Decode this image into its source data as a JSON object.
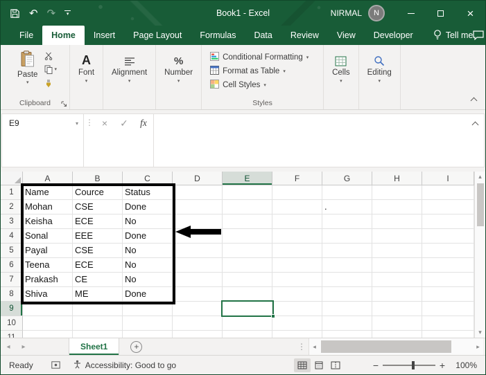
{
  "window": {
    "title": "Book1 - Excel",
    "user_name": "NIRMAL",
    "user_initial": "N"
  },
  "ribbon_tabs": {
    "active": "Home",
    "items": [
      "File",
      "Home",
      "Insert",
      "Page Layout",
      "Formulas",
      "Data",
      "Review",
      "View",
      "Developer"
    ],
    "tell_me": "Tell me"
  },
  "ribbon": {
    "paste_label": "Paste",
    "clipboard_group_label": "Clipboard",
    "font_label": "Font",
    "alignment_label": "Alignment",
    "number_label": "Number",
    "conditional_formatting_label": "Conditional Formatting",
    "format_as_table_label": "Format as Table",
    "cell_styles_label": "Cell Styles",
    "styles_group_label": "Styles",
    "cells_label": "Cells",
    "editing_label": "Editing"
  },
  "formula_bar": {
    "name_box": "E9",
    "fx_label": "fx",
    "formula_value": ""
  },
  "grid": {
    "columns": [
      "A",
      "B",
      "C",
      "D",
      "E",
      "F",
      "G",
      "H",
      "I"
    ],
    "visible_rows": 11,
    "selected_cell": "E9",
    "selected_column": "E",
    "selected_row": "9",
    "highlight_range": "A1:C8",
    "cells": {
      "A1": "Name",
      "B1": "Cource",
      "C1": "Status",
      "A2": "Mohan",
      "B2": "CSE",
      "C2": "Done",
      "A3": "Keisha",
      "B3": "ECE",
      "C3": "No",
      "A4": "Sonal",
      "B4": "EEE",
      "C4": "Done",
      "A5": "Payal",
      "B5": "CSE",
      "C5": "No",
      "A6": "Teena",
      "B6": "ECE",
      "C6": "No",
      "A7": "Prakash",
      "B7": "CE",
      "C7": "No",
      "A8": "Shiva",
      "B8": "ME",
      "C8": "Done",
      "G2": "."
    }
  },
  "sheet_bar": {
    "active_sheet": "Sheet1"
  },
  "status_bar": {
    "mode": "Ready",
    "accessibility": "Accessibility: Good to go",
    "zoom_level": "100%"
  },
  "colors": {
    "titlebar_green": "#185C37",
    "accent_green": "#217346"
  }
}
